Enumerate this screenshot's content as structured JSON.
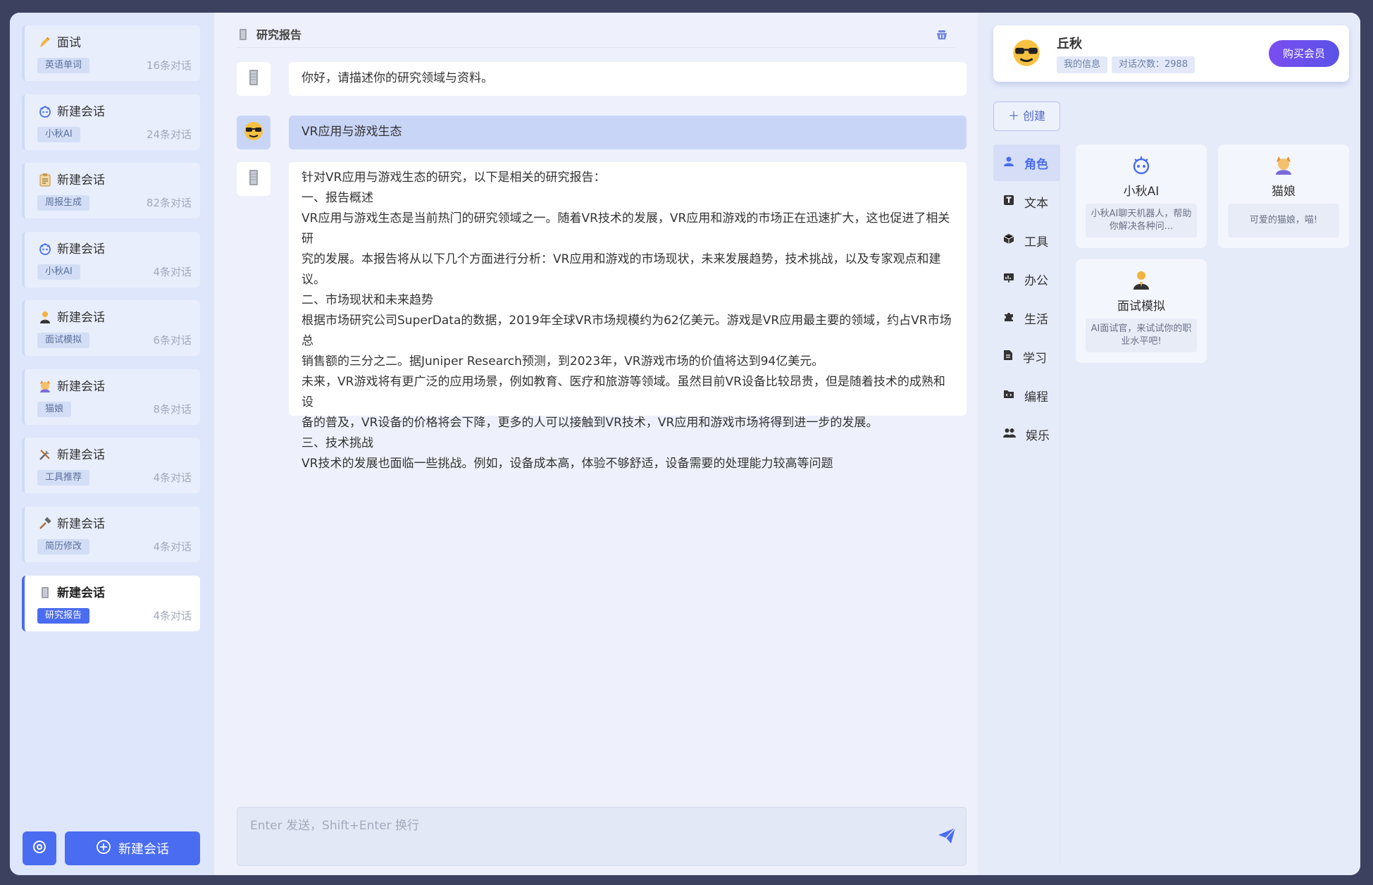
{
  "sidebar": {
    "conversations": [
      {
        "icon": "writing-hand-icon",
        "title": "面试",
        "tag": "英语单词",
        "count": "16条对话"
      },
      {
        "icon": "robot-icon",
        "title": "新建会话",
        "tag": "小秋AI",
        "count": "24条对话"
      },
      {
        "icon": "clipboard-icon",
        "title": "新建会话",
        "tag": "周报生成",
        "count": "82条对话"
      },
      {
        "icon": "robot-icon",
        "title": "新建会话",
        "tag": "小秋AI",
        "count": "4条对话"
      },
      {
        "icon": "interviewer-icon",
        "title": "新建会话",
        "tag": "面试模拟",
        "count": "6条对话"
      },
      {
        "icon": "cat-girl-icon",
        "title": "新建会话",
        "tag": "猫娘",
        "count": "8条对话"
      },
      {
        "icon": "tools-icon",
        "title": "新建会话",
        "tag": "工具推荐",
        "count": "4条对话"
      },
      {
        "icon": "hammer-icon",
        "title": "新建会话",
        "tag": "简历修改",
        "count": "4条对话"
      },
      {
        "icon": "report-icon",
        "title": "新建会话",
        "tag": "研究报告",
        "count": "4条对话",
        "active": true
      }
    ],
    "new_chat_label": "新建会话"
  },
  "chat": {
    "title": "研究报告",
    "messages": [
      {
        "role": "assistant",
        "text": "你好，请描述你的研究领域与资料。"
      },
      {
        "role": "user",
        "text": "VR应用与游戏生态"
      },
      {
        "role": "assistant",
        "lines": [
          "针对VR应用与游戏生态的研究，以下是相关的研究报告：",
          "一、报告概述",
          "VR应用与游戏生态是当前热门的研究领域之一。随着VR技术的发展，VR应用和游戏的市场正在迅速扩大，这也促进了相关研",
          "究的发展。本报告将从以下几个方面进行分析：VR应用和游戏的市场现状，未来发展趋势，技术挑战，以及专家观点和建",
          "议。",
          "二、市场现状和未来趋势",
          "根据市场研究公司SuperData的数据，2019年全球VR市场规模约为62亿美元。游戏是VR应用最主要的领域，约占VR市场总",
          "销售额的三分之二。据Juniper Research预测，到2023年，VR游戏市场的价值将达到94亿美元。",
          "未来，VR游戏将有更广泛的应用场景，例如教育、医疗和旅游等领域。虽然目前VR设备比较昂贵，但是随着技术的成熟和设",
          "备的普及，VR设备的价格将会下降，更多的人可以接触到VR技术，VR应用和游戏市场将得到进一步的发展。",
          "三、技术挑战",
          "VR技术的发展也面临一些挑战。例如，设备成本高，体验不够舒适，设备需要的处理能力较高等问题"
        ]
      }
    ],
    "input": {
      "placeholder": "Enter 发送，Shift+Enter 换行",
      "value": ""
    }
  },
  "profile": {
    "name": "丘秋",
    "my_info": "我的信息",
    "chat_count": "对话次数：2988",
    "buy_label": "购买会员"
  },
  "create_label": "创建",
  "categories": [
    {
      "icon": "person-icon",
      "label": "角色",
      "active": true
    },
    {
      "icon": "text-icon",
      "label": "文本"
    },
    {
      "icon": "cube-icon",
      "label": "工具"
    },
    {
      "icon": "presentation-icon",
      "label": "办公"
    },
    {
      "icon": "puzzle-icon",
      "label": "生活"
    },
    {
      "icon": "document-icon",
      "label": "学习"
    },
    {
      "icon": "code-folder-icon",
      "label": "编程"
    },
    {
      "icon": "users-icon",
      "label": "娱乐"
    }
  ],
  "roles": [
    {
      "icon": "robot-icon",
      "name": "小秋AI",
      "desc": "小秋AI聊天机器人，帮助你解决各种问..."
    },
    {
      "icon": "cat-girl-icon",
      "name": "猫娘",
      "desc": "可爱的猫娘，喵!"
    },
    {
      "icon": "interviewer-icon",
      "name": "面试模拟",
      "desc": "AI面试官，来试试你的职业水平吧!"
    }
  ],
  "colors": {
    "accent": "#4a6cf0",
    "buy_gradient_start": "#7a4ef0",
    "buy_gradient_end": "#5a52e8"
  }
}
